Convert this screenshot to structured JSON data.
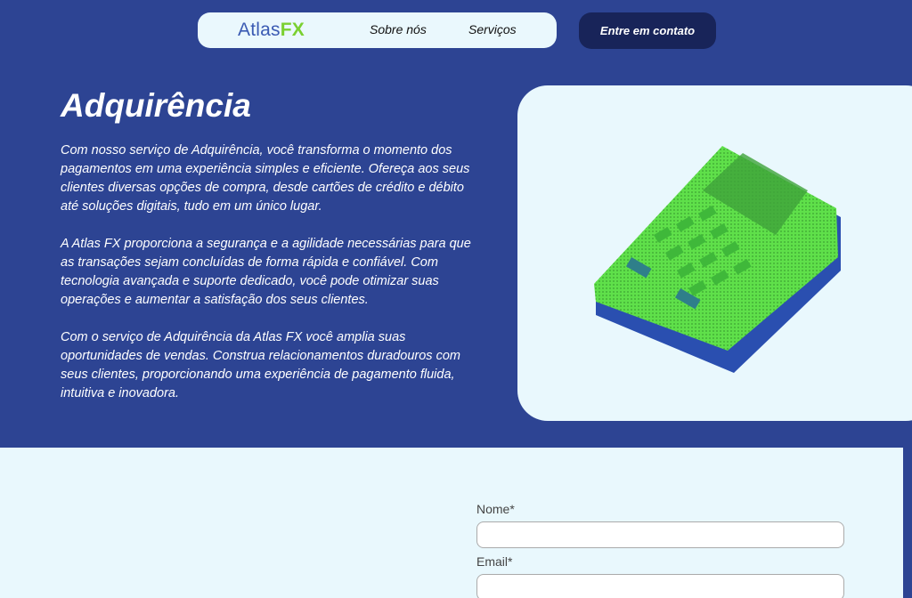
{
  "nav": {
    "logo_main": "Atlas",
    "logo_accent": "FX",
    "links": [
      "Sobre nós",
      "Serviços"
    ],
    "cta": "Entre em contato"
  },
  "hero": {
    "title": "Adquirência",
    "paragraphs": [
      "Com nosso serviço de Adquirência, você transforma o momento dos pagamentos em uma experiência simples e eficiente. Ofereça aos seus clientes diversas opções de compra, desde cartões de crédito e débito até soluções digitais, tudo em um único lugar.",
      "A Atlas FX proporciona a segurança e a agilidade necessárias para que as transações sejam concluídas de forma rápida e confiável. Com tecnologia avançada e suporte dedicado, você pode otimizar suas operações e aumentar a satisfação dos seus clientes.",
      "Com o serviço de Adquirência da Atlas FX você amplia suas oportunidades de vendas. Construa relacionamentos duradouros com seus clientes, proporcionando uma experiência de pagamento fluida, intuitiva e inovadora."
    ]
  },
  "form": {
    "name_label": "Nome*",
    "email_label": "Email*",
    "name_value": "",
    "email_value": ""
  },
  "colors": {
    "background": "#2d4493",
    "nav_pill": "#eaf8fd",
    "cta": "#182459",
    "logo_blue": "#3b5bb3",
    "logo_green": "#7ad030",
    "machine_green": "#5fe04a",
    "machine_blue": "#2a4fb0"
  },
  "icons": {
    "hero_image": "payment-terminal-icon"
  }
}
